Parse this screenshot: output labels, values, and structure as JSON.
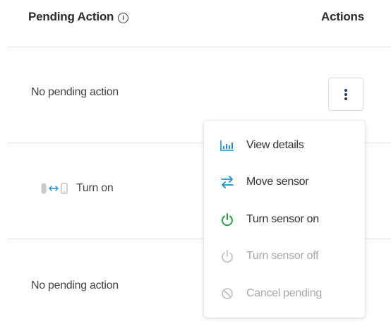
{
  "table": {
    "columns": {
      "pending_action": "Pending Action",
      "actions": "Actions"
    },
    "rows": [
      {
        "pending_action": "No pending action"
      },
      {
        "pending_action": "Turn on"
      },
      {
        "pending_action": "No pending action"
      }
    ]
  },
  "icons": {
    "info": "info-icon",
    "kebab": "vertical-dots-icon",
    "device_sensor": "sensor-icon",
    "transfer_arrows": "left-right-arrow-icon",
    "device_phone": "phone-icon"
  },
  "menu": {
    "items": [
      {
        "label": "View details",
        "icon": "bar-chart-icon",
        "enabled": true
      },
      {
        "label": "Move sensor",
        "icon": "swap-arrows-icon",
        "enabled": true
      },
      {
        "label": "Turn sensor on",
        "icon": "power-icon",
        "enabled": true
      },
      {
        "label": "Turn sensor off",
        "icon": "power-icon",
        "enabled": false
      },
      {
        "label": "Cancel pending",
        "icon": "cancel-icon",
        "enabled": false
      }
    ]
  },
  "colors": {
    "accent_blue": "#1f8ed8",
    "power_green": "#21a53a",
    "disabled_gray": "#a8a8a8",
    "kebab_navy": "#1d3a6e"
  }
}
